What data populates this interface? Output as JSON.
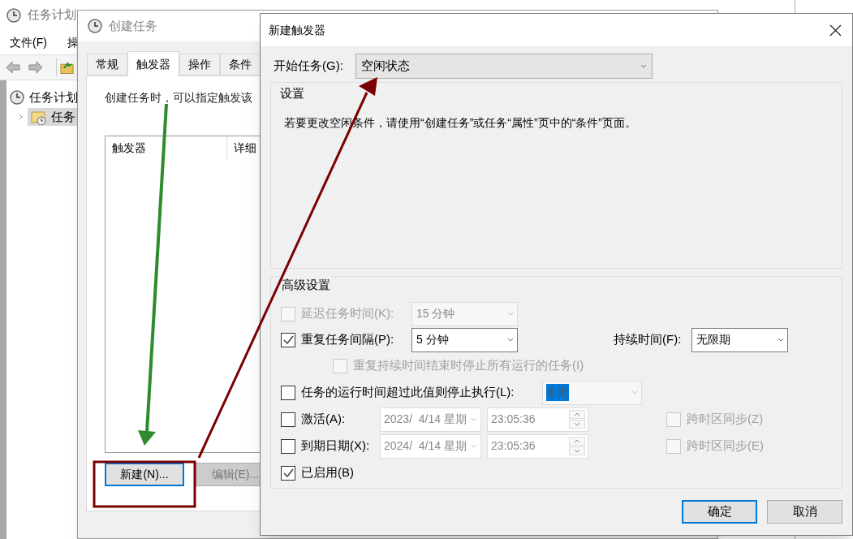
{
  "scheduler_window": {
    "title": "任务计划",
    "menu": [
      "文件(F)",
      "操"
    ],
    "tree": [
      {
        "label": "任务计划",
        "selected": false,
        "children": [
          {
            "label": "任务",
            "selected": true,
            "expanded": false
          }
        ]
      }
    ]
  },
  "create_task_window": {
    "title": "创建任务",
    "tabs": [
      {
        "label": "常规",
        "selected": false
      },
      {
        "label": "触发器",
        "selected": true
      },
      {
        "label": "操作",
        "selected": false
      },
      {
        "label": "条件",
        "selected": false
      }
    ],
    "description": "创建任务时，可以指定触发该",
    "table": {
      "columns": [
        "触发器",
        "详细"
      ]
    },
    "buttons": [
      {
        "label": "新建(N)...",
        "disabled": false,
        "focused": true
      },
      {
        "label": "编辑(E)...",
        "disabled": true,
        "focused": false
      }
    ]
  },
  "new_trigger_dialog": {
    "title": "新建触发器",
    "begin_task": {
      "label": "开始任务(G):",
      "value": "空闲状态"
    },
    "settings": {
      "title": "设置",
      "message": "若要更改空闲条件，请使用“创建任务”或任务“属性”页中的“条件”页面。"
    },
    "advanced": {
      "title": "高级设置",
      "delay": {
        "label": "延迟任务时间(K):",
        "checked": false,
        "disabled": true,
        "value": "15 分钟"
      },
      "repeat": {
        "label": "重复任务间隔(P):",
        "checked": true,
        "disabled": false,
        "value": "5 分钟",
        "duration_label": "持续时间(F):",
        "duration_value": "无限期"
      },
      "stop_at_end": {
        "label": "重复持续时间结束时停止所有运行的任务(I)",
        "checked": false,
        "disabled": true
      },
      "stop_if_longer": {
        "label": "任务的运行时间超过此值则停止执行(L):",
        "checked": false,
        "disabled": false,
        "value": "3 天",
        "value_disabled": true,
        "value_highlighted": true
      },
      "activate": {
        "label": "激活(A):",
        "checked": false,
        "date": "2023/  4/14 星期",
        "time": "23:05:36",
        "fields_disabled": true,
        "sync_label": "跨时区同步(Z)",
        "sync_checked": false,
        "sync_disabled": true
      },
      "expire": {
        "label": "到期日期(X):",
        "checked": false,
        "date": "2024/  4/14 星期",
        "time": "23:05:36",
        "fields_disabled": true,
        "sync_label": "跨时区同步(E)",
        "sync_checked": false,
        "sync_disabled": true
      },
      "enabled": {
        "label": "已启用(B)",
        "checked": true
      }
    },
    "buttons": [
      {
        "label": "确定",
        "default": true
      },
      {
        "label": "取消",
        "default": false
      }
    ]
  }
}
